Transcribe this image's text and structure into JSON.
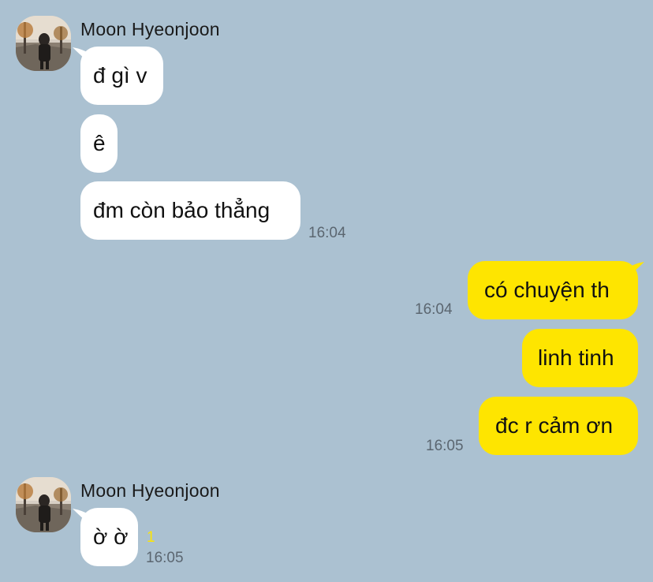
{
  "colors": {
    "background": "#abc1d1",
    "incoming_bubble": "#ffffff",
    "outgoing_bubble": "#fee500",
    "unread_count": "#fee500"
  },
  "groups": [
    {
      "sender": "Moon Hyeonjoon",
      "messages": [
        "đ gì v",
        "ê",
        "đm còn bảo thẳng"
      ],
      "time": "16:04"
    },
    {
      "sender": "Moon Hyeonjoon",
      "messages": [
        "ờ ờ"
      ],
      "unread": "1",
      "time": "16:05"
    }
  ],
  "outgoing": [
    {
      "text": "có chuyện th",
      "time": "16:04"
    },
    {
      "text": "linh tinh"
    },
    {
      "text": "đc r cảm ơn",
      "time": "16:05"
    }
  ]
}
